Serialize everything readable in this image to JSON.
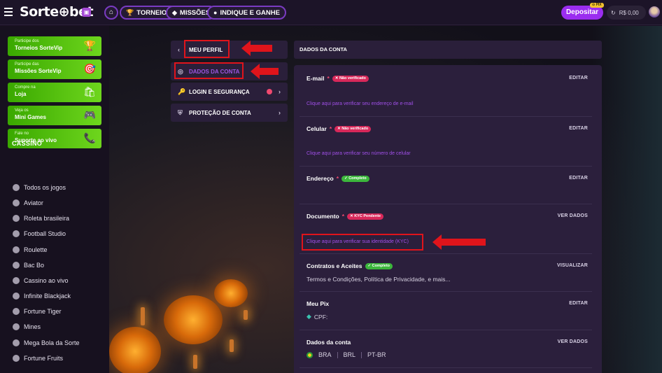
{
  "header": {
    "logo_text": "Sorte⊕bet",
    "nav": [
      {
        "label": "TORNEIOS"
      },
      {
        "label": "MISSÕES"
      },
      {
        "label": "INDIQUE E GANHE"
      }
    ],
    "deposit_label": "Depositar",
    "pix_badge": "⊙ PIX",
    "balance": "R$ 0,00"
  },
  "sidebar": {
    "promos": [
      {
        "small": "Participe dos",
        "big": "Torneios SorteVip",
        "icon": "🏆"
      },
      {
        "small": "Participe das",
        "big": "Missões SorteVip",
        "icon": "🎯"
      },
      {
        "small": "Compre na",
        "big": "Loja",
        "icon": "🛍"
      },
      {
        "small": "Veja os",
        "big": "Mini Games",
        "icon": "🎮"
      },
      {
        "small": "Fale no",
        "big": "Suporte ao vivo",
        "icon": "📞"
      }
    ],
    "section_title": "CASSINO",
    "games": [
      "Todos os jogos",
      "Aviator",
      "Roleta brasileira",
      "Football Studio",
      "Roulette",
      "Bac Bo",
      "Cassino ao vivo",
      "Infinite Blackjack",
      "Fortune Tiger",
      "Mines",
      "Mega Bola da Sorte",
      "Fortune Fruits"
    ]
  },
  "account_menu": {
    "meu_perfil": "MEU PERFIL",
    "dados_conta": "DADOS DA CONTA",
    "login_seguranca": "LOGIN E SEGURANÇA",
    "protecao_conta": "PROTEÇÃO DE CONTA"
  },
  "main": {
    "section_title": "DADOS DA CONTA",
    "email": {
      "label": "E-mail",
      "badge": "✕ Não verificado",
      "action": "EDITAR",
      "link": "Clique aqui para verificar seu endereço de e-mail"
    },
    "celular": {
      "label": "Celular",
      "badge": "✕ Não verificado",
      "action": "EDITAR",
      "link": "Clique aqui para verificar seu número de celular"
    },
    "endereco": {
      "label": "Endereço",
      "badge": "✓ Completo",
      "action": "EDITAR"
    },
    "documento": {
      "label": "Documento",
      "badge": "✕ KYC Pendente",
      "action": "VER DADOS",
      "link": "Clique aqui para verificar sua identidade (KYC)"
    },
    "contratos": {
      "label": "Contratos e Aceites",
      "badge": "✓ Completo",
      "action": "VISUALIZAR",
      "text": "Termos e Condições, Política de Privacidade, e mais..."
    },
    "pix": {
      "label": "Meu Pix",
      "action": "EDITAR",
      "text": "CPF:"
    },
    "dados": {
      "label": "Dados da conta",
      "action": "VER DADOS",
      "country": "BRA",
      "currency": "BRL",
      "language": "PT-BR"
    }
  }
}
